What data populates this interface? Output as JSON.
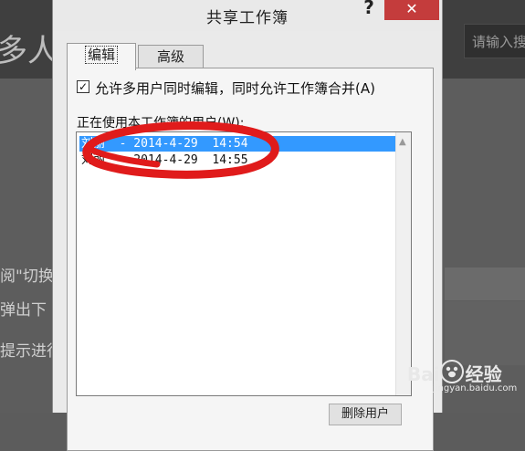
{
  "background": {
    "page_title_fragment": "多人",
    "search_placeholder": "请输入搜",
    "line1": "阅\"切换",
    "line2": "弹出下",
    "line3": "提示进行"
  },
  "watermark": {
    "brand": "Bai",
    "brand_cn": "经验",
    "url": "jingyan.baidu.com"
  },
  "dialog": {
    "title": "共享工作簿",
    "help_glyph": "?",
    "close_glyph": "✕",
    "tabs": [
      {
        "label": "编辑",
        "active": true
      },
      {
        "label": "高级",
        "active": false
      }
    ],
    "allow_multi_edit": {
      "checked": true,
      "check_glyph": "✓",
      "label": "允许多用户同时编辑，同时允许工作簿合并(A)"
    },
    "users_label": "正在使用本工作簿的用户(W):",
    "users": [
      {
        "text": "刘丽  - 2014-4-29  14:54",
        "selected": true
      },
      {
        "text": "刘丽  - 2014-4-29  14:55",
        "selected": false
      }
    ],
    "remove_button_partial": "删除用户"
  },
  "colors": {
    "annotation": "#e01b1b",
    "selection": "#3399ff",
    "close": "#c43c3c"
  }
}
